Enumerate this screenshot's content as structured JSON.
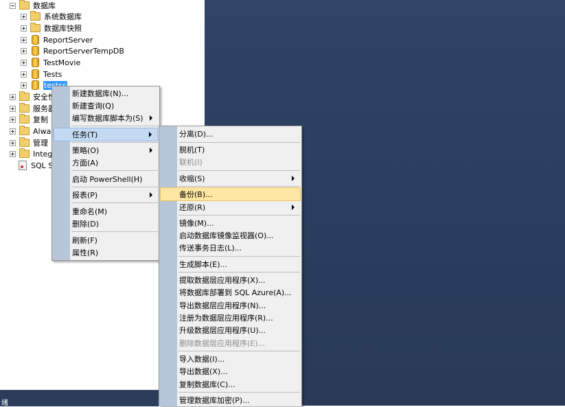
{
  "explorer": {
    "items": [
      {
        "label": "数据库"
      },
      {
        "label": "系统数据库"
      },
      {
        "label": "数据库快照"
      },
      {
        "label": "ReportServer"
      },
      {
        "label": "ReportServerTempDB"
      },
      {
        "label": "TestMovie"
      },
      {
        "label": "Tests"
      },
      {
        "label": "testss"
      },
      {
        "label": "安全性"
      },
      {
        "label": "服务器"
      },
      {
        "label": "复制"
      },
      {
        "label": "Always"
      },
      {
        "label": "管理"
      },
      {
        "label": "Integr"
      },
      {
        "label": "SQL Se"
      }
    ],
    "status": "绪"
  },
  "context_menu": {
    "items": [
      {
        "label": "新建数据库(N)..."
      },
      {
        "label": "新建查询(Q)"
      },
      {
        "label": "编写数据库脚本为(S)"
      },
      {
        "label": "任务(T)"
      },
      {
        "label": "策略(O)"
      },
      {
        "label": "方面(A)"
      },
      {
        "label": "启动 PowerShell(H)"
      },
      {
        "label": "报表(P)"
      },
      {
        "label": "重命名(M)"
      },
      {
        "label": "删除(D)"
      },
      {
        "label": "刷新(F)"
      },
      {
        "label": "属性(R)"
      }
    ]
  },
  "tasks_menu": {
    "items": [
      {
        "label": "分离(D)..."
      },
      {
        "label": "脱机(T)"
      },
      {
        "label": "联机(I)"
      },
      {
        "label": "收缩(S)"
      },
      {
        "label": "备份(B)..."
      },
      {
        "label": "还原(R)"
      },
      {
        "label": "镜像(M)..."
      },
      {
        "label": "启动数据库镜像监视器(O)..."
      },
      {
        "label": "传送事务日志(L)..."
      },
      {
        "label": "生成脚本(E)..."
      },
      {
        "label": "提取数据层应用程序(X)..."
      },
      {
        "label": "将数据库部署到 SQL Azure(A)..."
      },
      {
        "label": "导出数据层应用程序(N)..."
      },
      {
        "label": "注册为数据层应用程序(R)..."
      },
      {
        "label": "升级数据层应用程序(U)..."
      },
      {
        "label": "删除数据层应用程序(E)..."
      },
      {
        "label": "导入数据(I)..."
      },
      {
        "label": "导出数据(X)..."
      },
      {
        "label": "复制数据库(C)..."
      },
      {
        "label": "管理数据库加密(P)..."
      }
    ]
  }
}
